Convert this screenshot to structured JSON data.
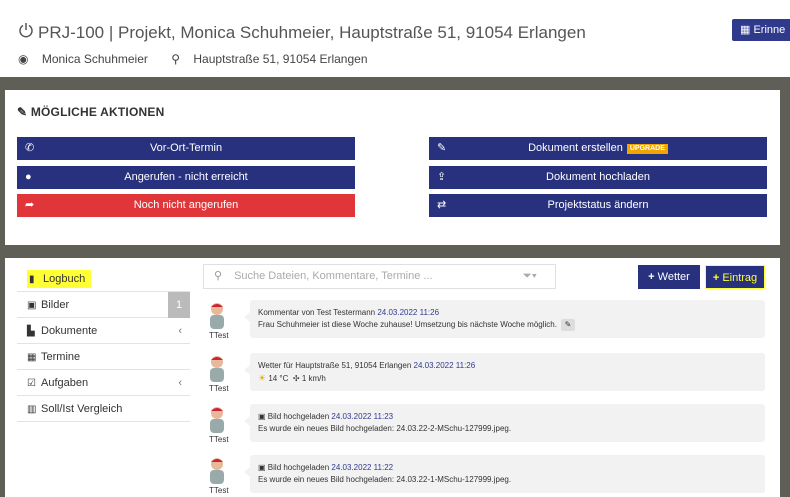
{
  "header": {
    "title": "PRJ-100 | Projekt, Monica Schuhmeier, Hauptstraße 51, 91054 Erlangen",
    "customer": "Monica Schuhmeier",
    "address": "Hauptstraße 51, 91054 Erlangen",
    "remind_label": "Erinne"
  },
  "actions": {
    "title": "MÖGLICHE AKTIONEN",
    "onsite": "Vor-Ort-Termin",
    "called_not_reached": "Angerufen - nicht erreicht",
    "not_called": "Noch nicht angerufen",
    "create_doc": "Dokument erstellen",
    "upgrade": "UPGRADE",
    "upload_doc": "Dokument hochladen",
    "change_status": "Projektstatus ändern"
  },
  "colors": {
    "primary": "#28317d",
    "danger": "#e0363a",
    "highlight": "#ffff33"
  },
  "sidebar": {
    "items": [
      {
        "label": "Logbuch"
      },
      {
        "label": "Bilder",
        "badge": "1"
      },
      {
        "label": "Dokumente"
      },
      {
        "label": "Termine"
      },
      {
        "label": "Aufgaben"
      },
      {
        "label": "Soll/Ist Vergleich"
      }
    ]
  },
  "toolbar": {
    "search_placeholder": "Suche Dateien, Kommentare, Termine ...",
    "weather_label": "Wetter",
    "entry_label": "Eintrag"
  },
  "log": {
    "entries": [
      {
        "user": "TTest",
        "head": "Kommentar von Test Testermann",
        "date": "24.03.2022 11:26",
        "body": "Frau Schuhmeier ist diese Woche zuhause! Umsetzung bis nächste Woche möglich."
      },
      {
        "user": "TTest",
        "head": "Wetter für Hauptstraße 51, 91054 Erlangen",
        "date": "24.03.2022 11:26",
        "temp": "14 °C",
        "wind": "1 km/h"
      },
      {
        "user": "TTest",
        "head": "Bild hochgeladen",
        "date": "24.03.2022 11:23",
        "body": "Es wurde ein neues Bild hochgeladen: 24.03.22-2-MSchu-127999.jpeg."
      },
      {
        "user": "TTest",
        "head": "Bild hochgeladen",
        "date": "24.03.2022 11:22",
        "body": "Es wurde ein neues Bild hochgeladen: 24.03.22-1-MSchu-127999.jpeg."
      }
    ]
  }
}
